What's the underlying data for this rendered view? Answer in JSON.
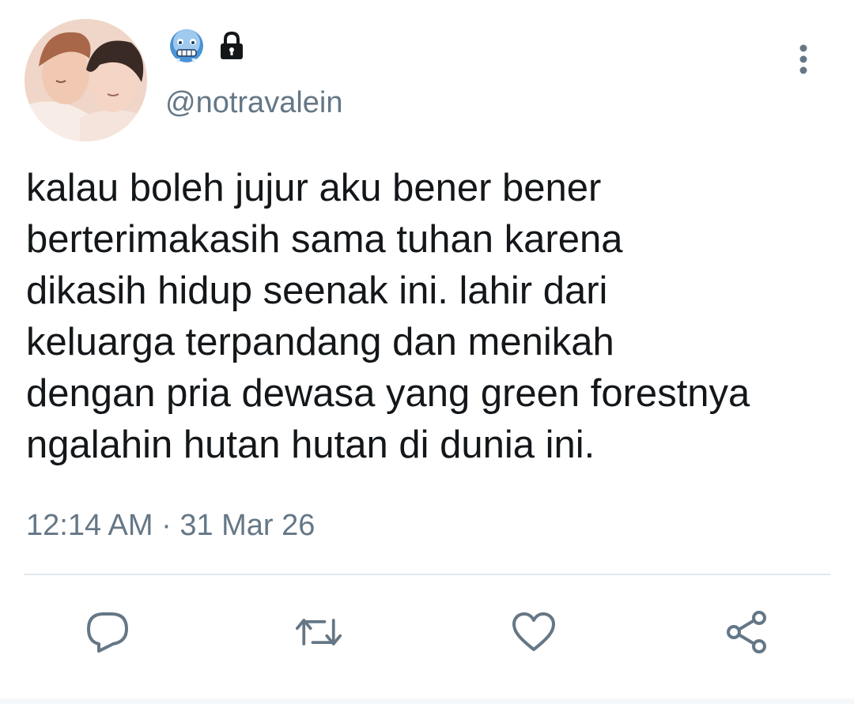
{
  "tweet": {
    "handle": "@notravalein",
    "name_icons": [
      "cold-face-emoji",
      "lock-icon"
    ],
    "text": "kalau boleh jujur aku bener bener berterimakasih sama tuhan karena dikasih hidup seenak ini. lahir dari keluarga terpandang dan menikah dengan pria dewasa yang green forestnya ngalahin hutan hutan di dunia ini.",
    "text_lines": [
      "kalau boleh jujur aku bener bener",
      "berterimakasih sama tuhan karena",
      "dikasih hidup seenak ini. lahir dari",
      "keluarga terpandang dan menikah",
      "dengan pria dewasa yang green forestnya",
      "ngalahin hutan hutan di dunia ini."
    ],
    "timestamp": "12:14 AM · 31 Mar 26"
  },
  "actions": [
    "reply-icon",
    "retweet-icon",
    "like-icon",
    "share-icon"
  ],
  "colors": {
    "text": "#14171a",
    "secondary": "#657786",
    "divider": "#e1e8ed"
  }
}
